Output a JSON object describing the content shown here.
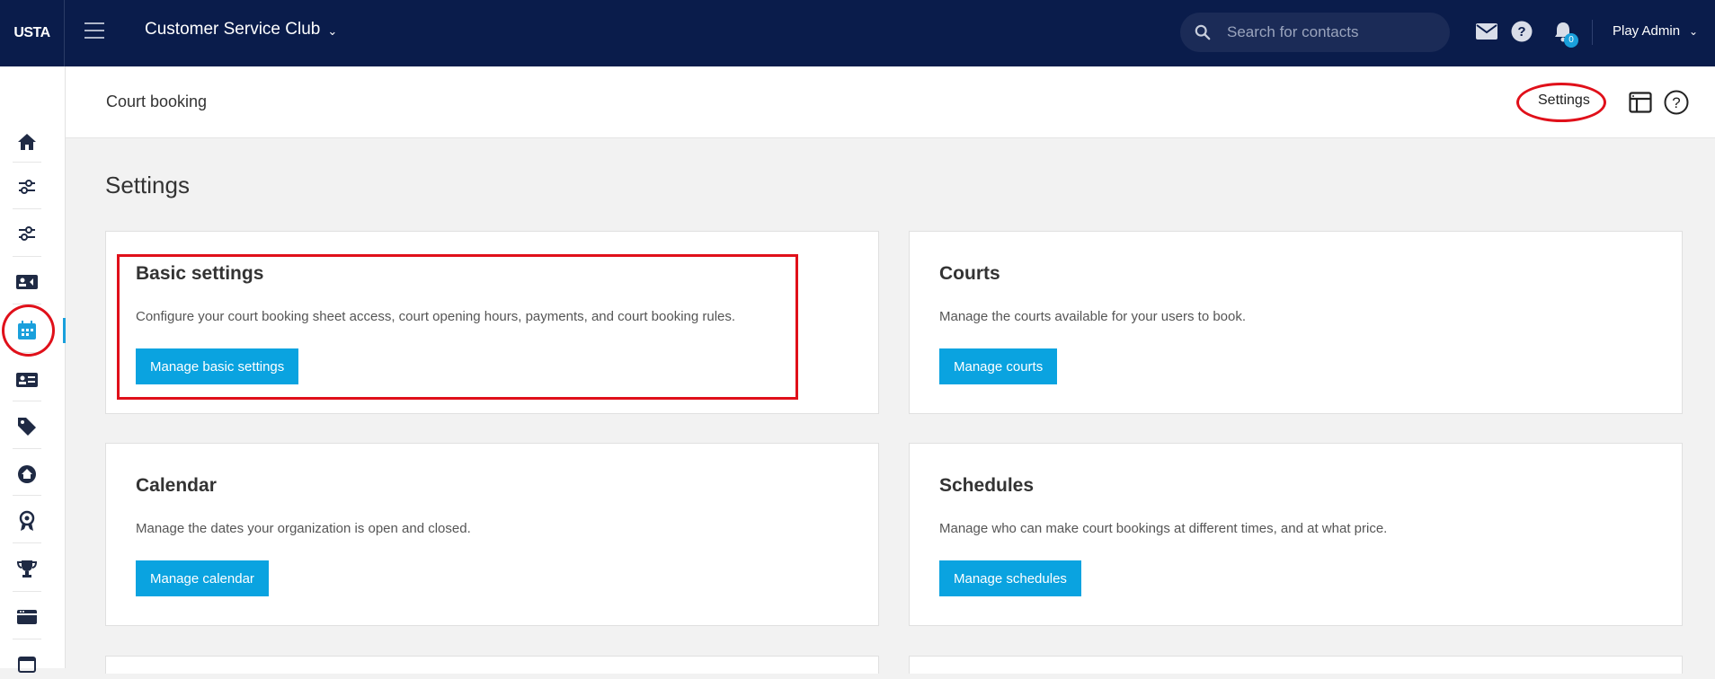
{
  "app": {
    "logo": "USTA",
    "club_name": "Customer Service Club",
    "search_placeholder": "Search for contacts",
    "notification_count": "0",
    "user_name": "Play Admin"
  },
  "page_header": {
    "breadcrumb": "Court booking",
    "settings_link": "Settings"
  },
  "main": {
    "title": "Settings",
    "cards": [
      {
        "title": "Basic settings",
        "description": "Configure your court booking sheet access, court opening hours, payments, and court booking rules.",
        "button": "Manage basic settings"
      },
      {
        "title": "Courts",
        "description": "Manage the courts available for your users to book.",
        "button": "Manage courts"
      },
      {
        "title": "Calendar",
        "description": "Manage the dates your organization is open and closed.",
        "button": "Manage calendar"
      },
      {
        "title": "Schedules",
        "description": "Manage who can make court bookings at different times, and at what price.",
        "button": "Manage schedules"
      }
    ]
  },
  "sidebar": {
    "icons": [
      "home-icon",
      "sliders-icon",
      "sliders-icon",
      "id-card-icon",
      "calendar-icon",
      "contact-card-icon",
      "tags-icon",
      "home-circle-icon",
      "award-icon",
      "trophy-icon",
      "ticket-icon",
      "list-icon"
    ],
    "active_index": 4
  },
  "colors": {
    "topbar": "#0a1c4b",
    "accent": "#0aa3e0",
    "annotation": "#e0101a"
  }
}
